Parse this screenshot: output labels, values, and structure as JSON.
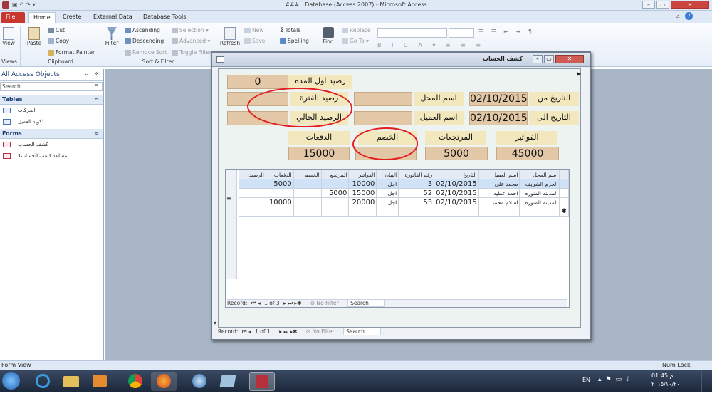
{
  "window": {
    "title": "### : Database (Access 2007) - Microsoft Access"
  },
  "tabs": [
    "File",
    "Home",
    "Create",
    "External Data",
    "Database Tools"
  ],
  "ribbon": {
    "views": {
      "view": "View",
      "group": "Views"
    },
    "clipboard": {
      "paste": "Paste",
      "cut": "Cut",
      "copy": "Copy",
      "format_painter": "Format Painter",
      "group": "Clipboard"
    },
    "sort_filter": {
      "filter": "Filter",
      "ascending": "Ascending",
      "descending": "Descending",
      "remove_sort": "Remove Sort",
      "selection": "Selection",
      "advanced": "Advanced",
      "toggle_filter": "Toggle Filter",
      "group": "Sort & Filter"
    },
    "records": {
      "refresh": "Refresh",
      "new": "New",
      "save": "Save",
      "totals": "Totals",
      "spelling": "Spelling"
    },
    "find": {
      "find": "Find",
      "replace": "Replace",
      "goto": "Go To"
    }
  },
  "navpane": {
    "title": "All Access Objects",
    "search_placeholder": "Search...",
    "tables_header": "Tables",
    "tables": [
      "الحركات",
      "تكويد العميل"
    ],
    "forms_header": "Forms",
    "forms": [
      "كشف الحساب",
      "مساعد كشف الحساب1"
    ]
  },
  "form": {
    "title": "كشف الحساب",
    "labels": {
      "opening_balance": "رصيد اول المده",
      "period_balance": "رصيد الفترة",
      "current_balance": "الرصيد الحالي",
      "shop_name": "اسم المحل",
      "customer_name": "اسم العميل",
      "date_from": "التاريخ من",
      "date_to": "التاريخ الى",
      "payments": "الدفعات",
      "discount": "الخصم",
      "returns": "المرتجعات",
      "invoices": "الفواتير"
    },
    "values": {
      "opening_balance": "0",
      "period_balance": "",
      "current_balance": "",
      "shop_name": "",
      "customer_name": "",
      "date_from": "02/10/2015",
      "date_to": "02/10/2015",
      "payments": "15000",
      "discount": "",
      "returns": "5000",
      "invoices": "45000"
    }
  },
  "datasheet": {
    "columns": [
      "الرصيد",
      "الدفعات",
      "الخصم",
      "المرتجع",
      "الفواتير",
      "البيان",
      "رقم الفاتورة",
      "التاريخ",
      "اسم العميل",
      "اسم المحل"
    ],
    "rows": [
      [
        "",
        "5000",
        "",
        "",
        "10000",
        "اجل",
        "3",
        "02/10/2015",
        "محمد على",
        "الحرم الشريف"
      ],
      [
        "",
        "",
        "",
        "5000",
        "15000",
        "اجل",
        "52",
        "02/10/2015",
        "احمد عطيه",
        "المدينه المنوره"
      ],
      [
        "",
        "10000",
        "",
        "",
        "20000",
        "اجل",
        "53",
        "02/10/2015",
        "اسلام محمد",
        "المدينه المنوره"
      ]
    ],
    "record_nav": {
      "label": "Record:",
      "position": "1 of 3",
      "filter": "No Filter",
      "search": "Search"
    }
  },
  "form_nav": {
    "label": "Record:",
    "position": "1 of 1",
    "filter": "No Filter",
    "search": "Search"
  },
  "status": {
    "left": "Form View",
    "right": "Num Lock"
  },
  "taskbar": {
    "lang": "EN",
    "time": "01:45 م",
    "date": "٢٠١٥/١٠/٢٠"
  }
}
